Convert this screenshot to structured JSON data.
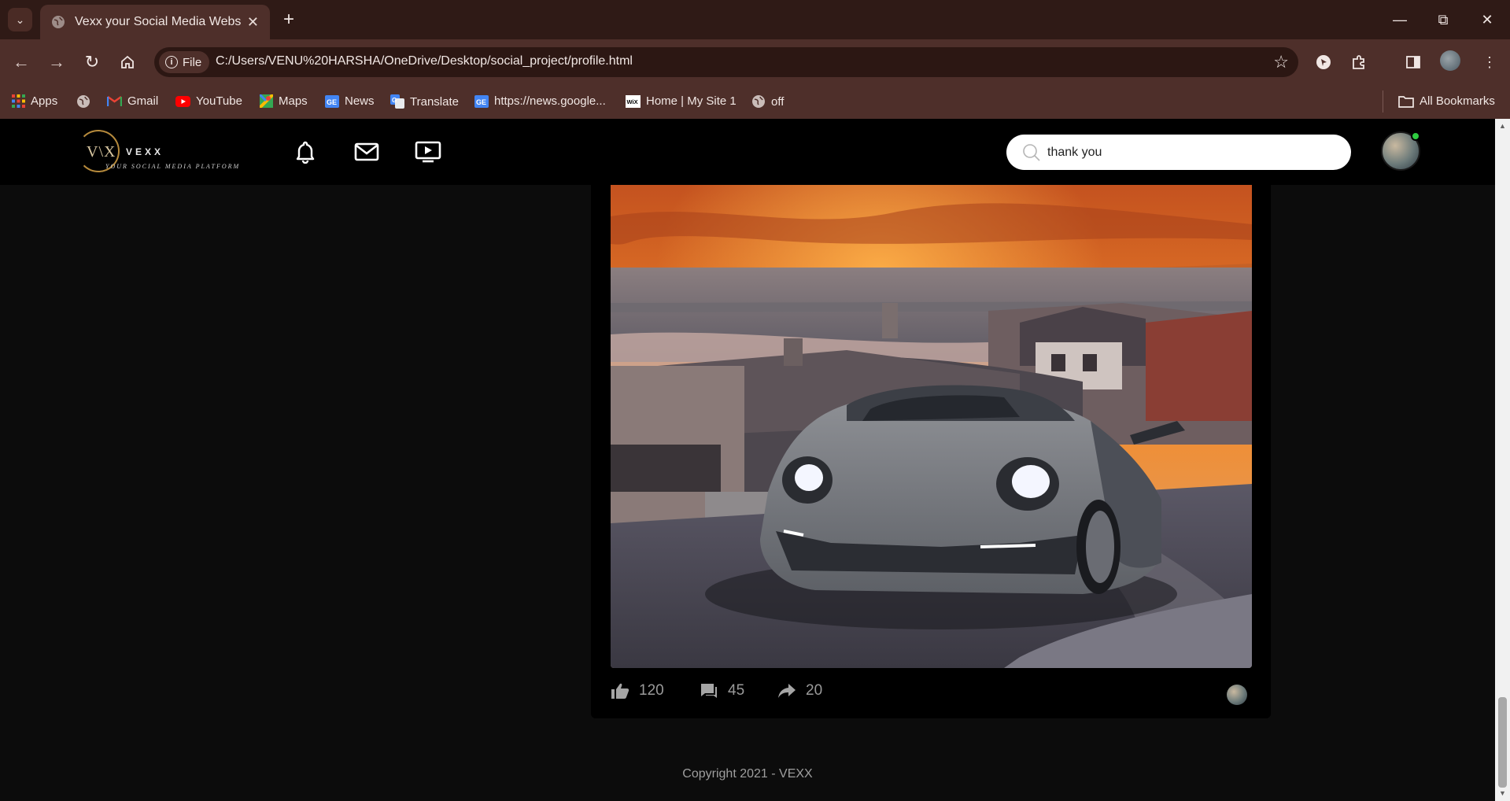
{
  "browser": {
    "tab_title": "Vexx your Social Media Website",
    "url_chip": "File",
    "url": "C:/Users/VENU%20HARSHA/OneDrive/Desktop/social_project/profile.html",
    "bookmarks": [
      {
        "label": "Apps",
        "icon": "apps-grid-icon"
      },
      {
        "label": "",
        "icon": "globe-icon"
      },
      {
        "label": "Gmail",
        "icon": "gmail-icon"
      },
      {
        "label": "YouTube",
        "icon": "youtube-icon"
      },
      {
        "label": "Maps",
        "icon": "maps-icon"
      },
      {
        "label": "News",
        "icon": "google-news-icon"
      },
      {
        "label": "Translate",
        "icon": "translate-icon"
      },
      {
        "label": "https://news.google...",
        "icon": "google-news-icon"
      },
      {
        "label": "Home | My Site 1",
        "icon": "wix-icon"
      },
      {
        "label": "off",
        "icon": "globe-icon"
      }
    ],
    "all_bookmarks": "All Bookmarks"
  },
  "site": {
    "logo": {
      "monogram": "V\\X",
      "name": "VEXX",
      "tagline": "YOUR SOCIAL MEDIA PLATFORM"
    },
    "search_value": "thank you",
    "post": {
      "likes": "120",
      "comments": "45",
      "shares": "20"
    },
    "footer": "Copyright 2021 - VEXX"
  },
  "colors": {
    "chrome_dark": "#2f1a16",
    "chrome": "#4e2f2a",
    "page_bg": "#0c0c0c",
    "header_bg": "#000000",
    "online": "#2ecc40",
    "logo_gold": "#b68a3c"
  }
}
